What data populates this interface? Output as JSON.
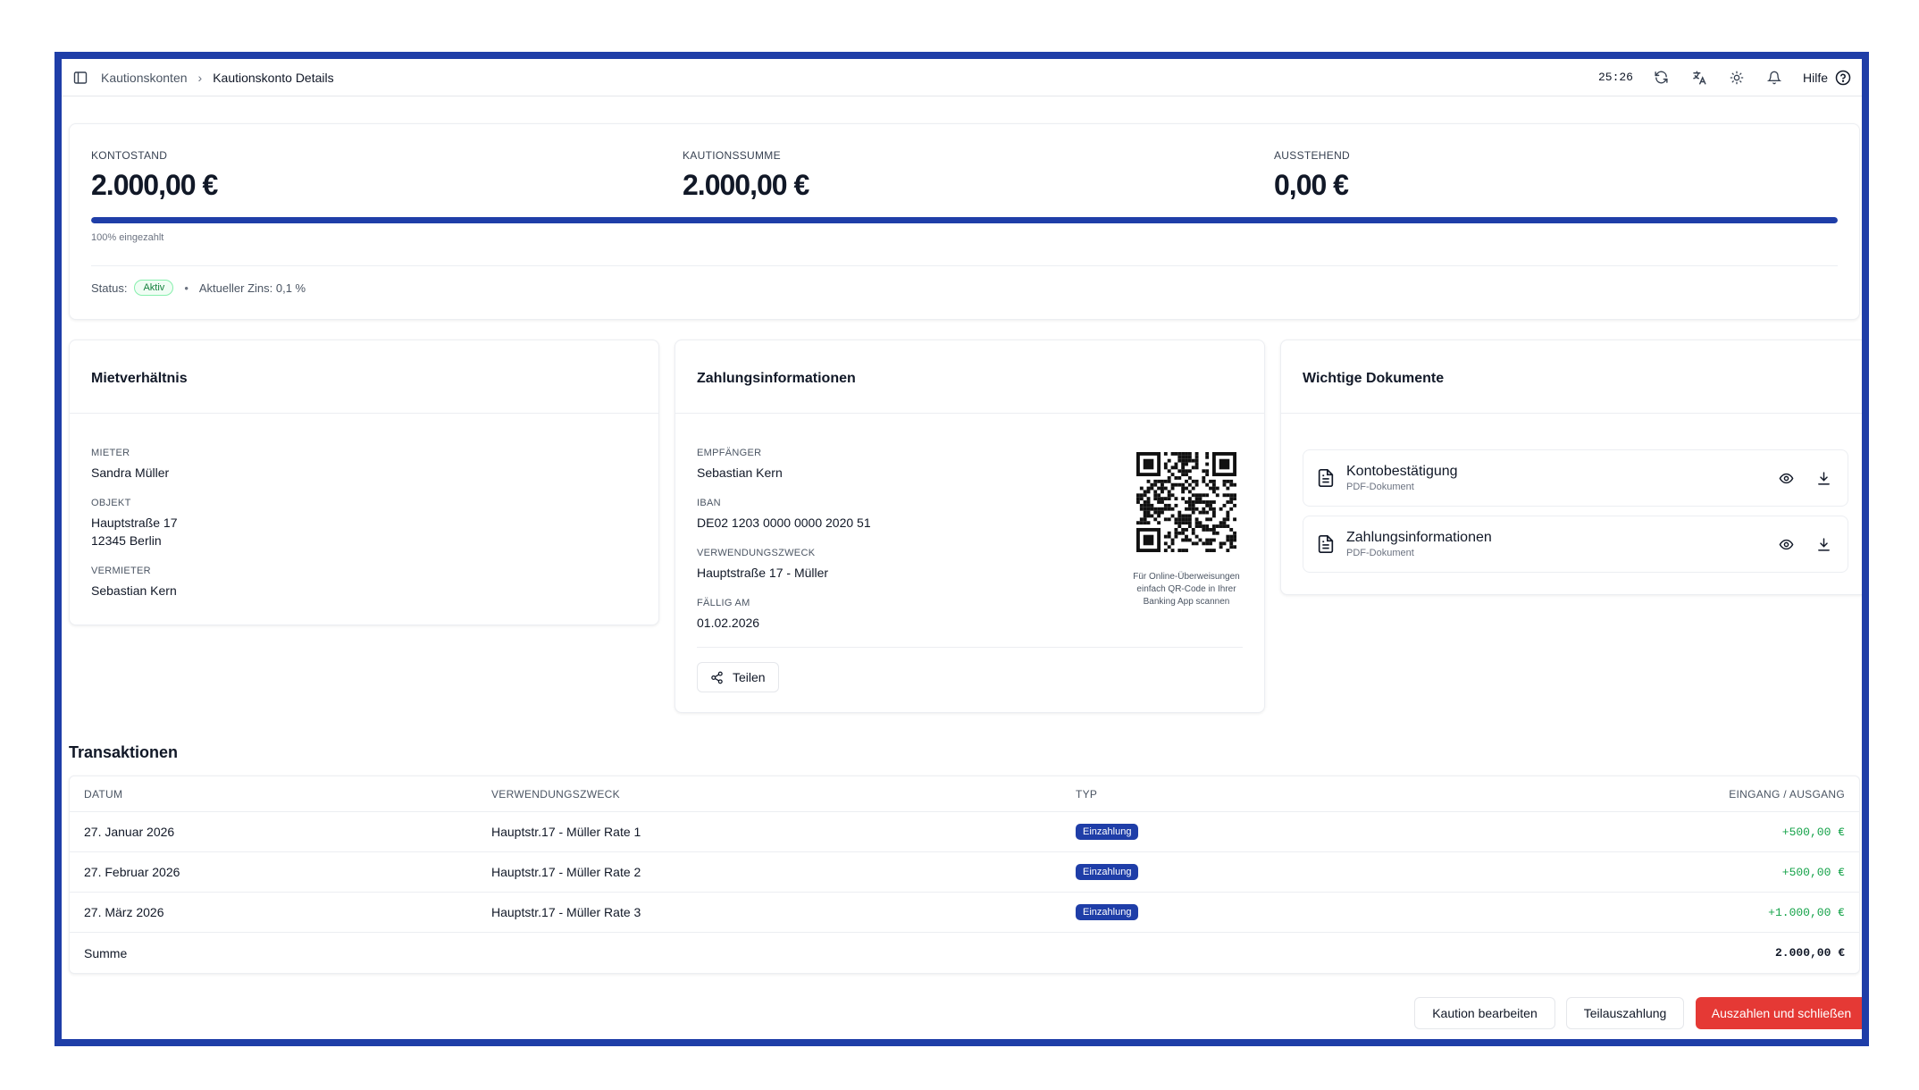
{
  "topbar": {
    "breadcrumbs": [
      "Kautionskonten",
      "Kautionskonto Details"
    ],
    "timer": "25:26",
    "help_label": "Hilfe"
  },
  "summary": {
    "balance_label": "KONTOSTAND",
    "balance_value": "2.000,00 €",
    "deposit_label": "KAUTIONSSUMME",
    "deposit_value": "2.000,00 €",
    "outstanding_label": "AUSSTEHEND",
    "outstanding_value": "0,00 €",
    "progress_percent": 100,
    "progress_text": "100% eingezahlt",
    "status_label": "Status:",
    "status_value": "Aktiv",
    "interest_text": "Aktueller Zins: 0,1 %",
    "colors": {
      "accent": "#1f3ea8",
      "status_green": "#15803d"
    }
  },
  "tenancy": {
    "title": "Mietverhältnis",
    "tenant_label": "MIETER",
    "tenant_value": "Sandra Müller",
    "object_label": "OBJEKT",
    "object_line1": "Hauptstraße 17",
    "object_line2": "12345 Berlin",
    "landlord_label": "VERMIETER",
    "landlord_value": "Sebastian Kern"
  },
  "payment": {
    "title": "Zahlungsinformationen",
    "recipient_label": "EMPFÄNGER",
    "recipient_value": "Sebastian Kern",
    "iban_label": "IBAN",
    "iban_value": "DE02 1203 0000 0000 2020 51",
    "purpose_label": "VERWENDUNGSZWECK",
    "purpose_value": "Hauptstraße 17 - Müller",
    "due_label": "FÄLLIG AM",
    "due_value": "01.02.2026",
    "qr_caption": "Für Online-Überweisungen einfach QR-Code in Ihrer Banking App scannen",
    "share_label": "Teilen"
  },
  "documents": {
    "title": "Wichtige Dokumente",
    "items": [
      {
        "name": "Kontobestätigung",
        "type": "PDF-Dokument"
      },
      {
        "name": "Zahlungsinformationen",
        "type": "PDF-Dokument"
      }
    ]
  },
  "transactions": {
    "title": "Transaktionen",
    "headers": {
      "date": "DATUM",
      "purpose": "VERWENDUNGSZWECK",
      "type": "TYP",
      "amount": "EINGANG / AUSGANG"
    },
    "rows": [
      {
        "date": "27. Januar 2026",
        "purpose": "Hauptstr.17 - Müller Rate 1",
        "type": "Einzahlung",
        "amount": "+500,00 €"
      },
      {
        "date": "27. Februar 2026",
        "purpose": "Hauptstr.17 - Müller Rate 2",
        "type": "Einzahlung",
        "amount": "+500,00 €"
      },
      {
        "date": "27. März 2026",
        "purpose": "Hauptstr.17 - Müller Rate 3",
        "type": "Einzahlung",
        "amount": "+1.000,00 €"
      }
    ],
    "sum_label": "Summe",
    "sum_value": "2.000,00 €"
  },
  "actions": {
    "edit_label": "Kaution bearbeiten",
    "partial_label": "Teilauszahlung",
    "payout_label": "Auszahlen und schließen",
    "colors": {
      "danger": "#e53935"
    }
  }
}
